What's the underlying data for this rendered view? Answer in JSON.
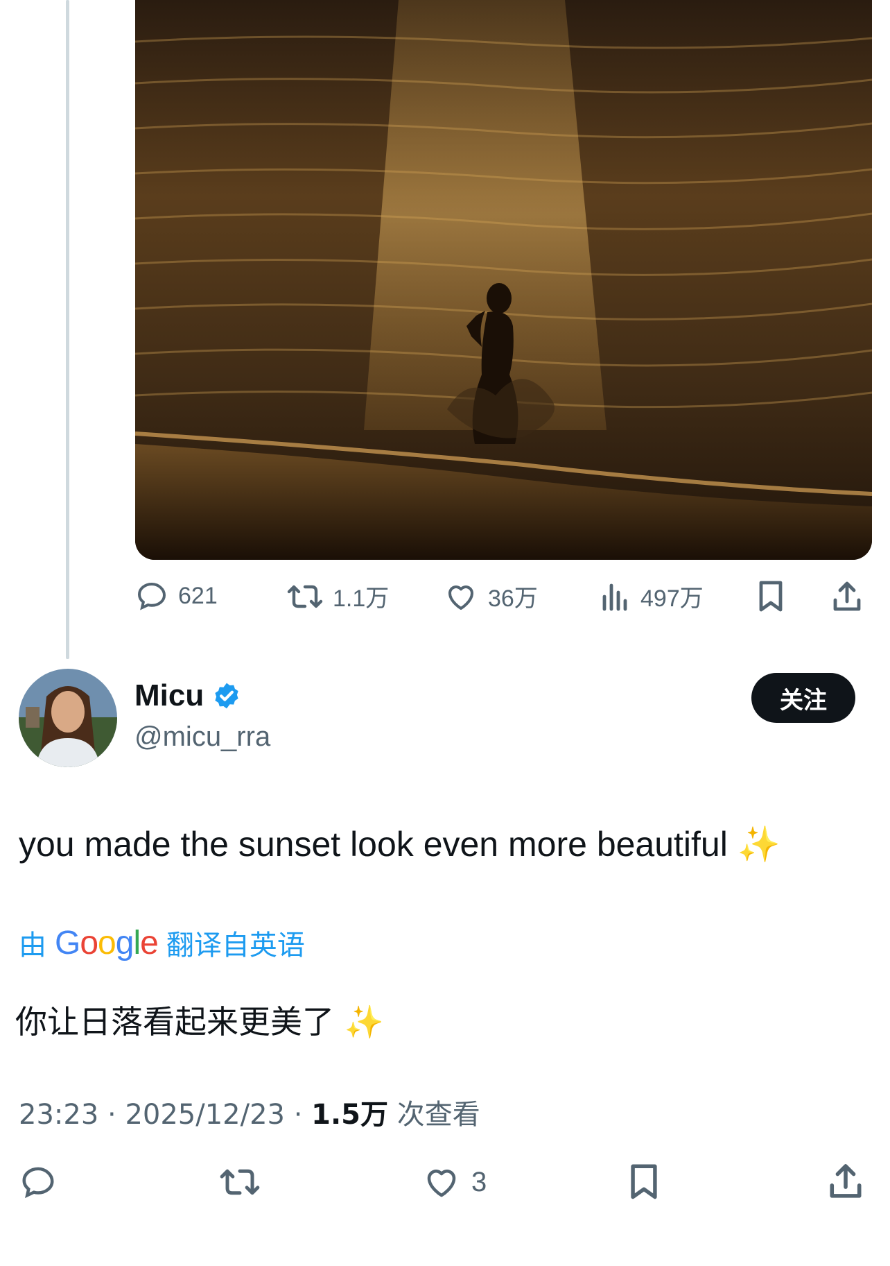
{
  "top_tweet": {
    "stats": {
      "replies": "621",
      "retweets": "1.1万",
      "likes": "36万",
      "views": "497万"
    }
  },
  "reply": {
    "display_name": "Micu",
    "handle": "@micu_rra",
    "follow_label": "关注",
    "text": "you made the sunset look even more beautiful",
    "emoji": "✨",
    "translated_prefix": "由",
    "translated_by": "Google",
    "translated_suffix": "翻译自英语",
    "translation": "你让日落看起来更美了",
    "time": "23:23",
    "date": "2025/12/23",
    "separator": "·",
    "views_count": "1.5万",
    "views_label": "次查看",
    "likes": "3"
  },
  "colors": {
    "accent": "#1d9bf0",
    "text": "#0f1419",
    "muted": "#536471",
    "google_blue": "#4285f4",
    "google_red": "#ea4335",
    "google_yellow": "#fbbc05",
    "google_green": "#34a853"
  },
  "icons": [
    "reply-icon",
    "retweet-icon",
    "like-icon",
    "views-icon",
    "bookmark-icon",
    "share-icon",
    "verified-badge-icon",
    "sparkles-icon"
  ]
}
